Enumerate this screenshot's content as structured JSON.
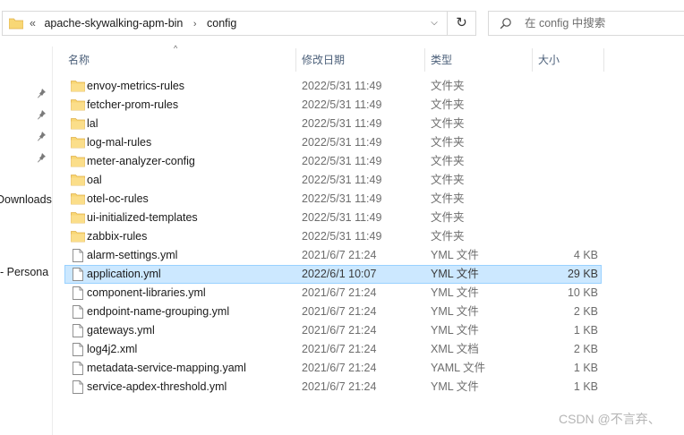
{
  "address": {
    "overflow": "«",
    "crumbs": [
      "apache-skywalking-apm-bin",
      "config"
    ],
    "separator": "›",
    "dropdown": "⌵"
  },
  "refresh_glyph": "↻",
  "search": {
    "placeholder": "在 config 中搜索"
  },
  "nav": {
    "downloads": "Downloads",
    "personal": "- Persona"
  },
  "columns": {
    "name": "名称",
    "modified": "修改日期",
    "type": "类型",
    "size": "大小"
  },
  "sort_indicator": "^",
  "files": [
    {
      "name": "envoy-metrics-rules",
      "date": "2022/5/31 11:49",
      "type": "文件夹",
      "size": "",
      "icon": "folder-icon"
    },
    {
      "name": "fetcher-prom-rules",
      "date": "2022/5/31 11:49",
      "type": "文件夹",
      "size": "",
      "icon": "folder-icon"
    },
    {
      "name": "lal",
      "date": "2022/5/31 11:49",
      "type": "文件夹",
      "size": "",
      "icon": "folder-icon"
    },
    {
      "name": "log-mal-rules",
      "date": "2022/5/31 11:49",
      "type": "文件夹",
      "size": "",
      "icon": "folder-icon"
    },
    {
      "name": "meter-analyzer-config",
      "date": "2022/5/31 11:49",
      "type": "文件夹",
      "size": "",
      "icon": "folder-icon"
    },
    {
      "name": "oal",
      "date": "2022/5/31 11:49",
      "type": "文件夹",
      "size": "",
      "icon": "folder-icon"
    },
    {
      "name": "otel-oc-rules",
      "date": "2022/5/31 11:49",
      "type": "文件夹",
      "size": "",
      "icon": "folder-icon"
    },
    {
      "name": "ui-initialized-templates",
      "date": "2022/5/31 11:49",
      "type": "文件夹",
      "size": "",
      "icon": "folder-icon"
    },
    {
      "name": "zabbix-rules",
      "date": "2022/5/31 11:49",
      "type": "文件夹",
      "size": "",
      "icon": "folder-icon"
    },
    {
      "name": "alarm-settings.yml",
      "date": "2021/6/7 21:24",
      "type": "YML 文件",
      "size": "4 KB",
      "icon": "file-icon"
    },
    {
      "name": "application.yml",
      "date": "2022/6/1 10:07",
      "type": "YML 文件",
      "size": "29 KB",
      "icon": "file-icon",
      "selected": true
    },
    {
      "name": "component-libraries.yml",
      "date": "2021/6/7 21:24",
      "type": "YML 文件",
      "size": "10 KB",
      "icon": "file-icon"
    },
    {
      "name": "endpoint-name-grouping.yml",
      "date": "2021/6/7 21:24",
      "type": "YML 文件",
      "size": "2 KB",
      "icon": "file-icon"
    },
    {
      "name": "gateways.yml",
      "date": "2021/6/7 21:24",
      "type": "YML 文件",
      "size": "1 KB",
      "icon": "file-icon"
    },
    {
      "name": "log4j2.xml",
      "date": "2021/6/7 21:24",
      "type": "XML 文档",
      "size": "2 KB",
      "icon": "file-icon"
    },
    {
      "name": "metadata-service-mapping.yaml",
      "date": "2021/6/7 21:24",
      "type": "YAML 文件",
      "size": "1 KB",
      "icon": "file-icon"
    },
    {
      "name": "service-apdex-threshold.yml",
      "date": "2021/6/7 21:24",
      "type": "YML 文件",
      "size": "1 KB",
      "icon": "file-icon"
    }
  ],
  "watermark": "CSDN @不言弃、",
  "colors": {
    "folder": "#f8d775",
    "folder_dark": "#e8b64c",
    "selection_bg": "#cce8ff",
    "selection_border": "#99d1ff",
    "header_text": "#4c607a"
  }
}
